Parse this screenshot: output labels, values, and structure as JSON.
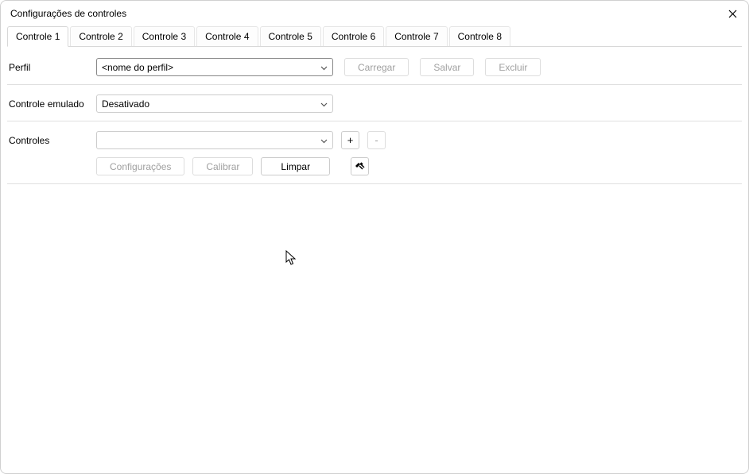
{
  "window": {
    "title": "Configurações de controles",
    "close_tooltip": "Fechar"
  },
  "tabs": [
    {
      "label": "Controle 1",
      "active": true
    },
    {
      "label": "Controle 2",
      "active": false
    },
    {
      "label": "Controle 3",
      "active": false
    },
    {
      "label": "Controle 4",
      "active": false
    },
    {
      "label": "Controle 5",
      "active": false
    },
    {
      "label": "Controle 6",
      "active": false
    },
    {
      "label": "Controle 7",
      "active": false
    },
    {
      "label": "Controle 8",
      "active": false
    }
  ],
  "profile": {
    "label": "Perfil",
    "selected": "<nome do perfil>",
    "load_label": "Carregar",
    "save_label": "Salvar",
    "delete_label": "Excluir"
  },
  "emulated": {
    "label": "Controle emulado",
    "selected": "Desativado"
  },
  "controller": {
    "label": "Controles",
    "selected": "",
    "add_label": "+",
    "remove_label": "-"
  },
  "actions": {
    "settings_label": "Configurações",
    "calibrate_label": "Calibrar",
    "clear_label": "Limpar"
  }
}
